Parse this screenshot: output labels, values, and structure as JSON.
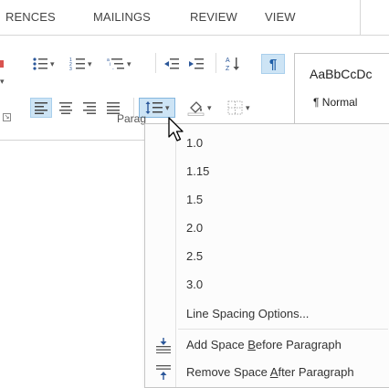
{
  "tabs": [
    {
      "label": "RENCES"
    },
    {
      "label": "MAILINGS"
    },
    {
      "label": "REVIEW"
    },
    {
      "label": "VIEW"
    }
  ],
  "ribbon": {
    "paragraph_group_label": "Parag",
    "styles": {
      "sample_text": "AaBbCcDc",
      "style_name": "¶ Normal"
    }
  },
  "line_spacing_menu": {
    "items": [
      {
        "label": "1.0"
      },
      {
        "label": "1.15"
      },
      {
        "label": "1.5"
      },
      {
        "label": "2.0"
      },
      {
        "label": "2.5"
      },
      {
        "label": "3.0"
      }
    ],
    "options_label": "Line Spacing Options...",
    "add_space_before": {
      "pre": "Add Space ",
      "accel": "B",
      "post": "efore Paragraph"
    },
    "remove_space_after": {
      "pre": "Remove Space ",
      "accel": "A",
      "post": "fter Paragraph"
    }
  },
  "colors": {
    "pressed_bg": "#cde4f5",
    "pressed_border": "#a9cfec",
    "accent_blue": "#2b579a",
    "pilcrow_blue": "#1f5fa8"
  },
  "icons": [
    "bullets-icon",
    "numbering-icon",
    "multilevel-list-icon",
    "decrease-indent-icon",
    "increase-indent-icon",
    "sort-icon",
    "show-formatting-icon",
    "align-left-icon",
    "align-center-icon",
    "align-right-icon",
    "justify-icon",
    "line-spacing-icon",
    "shading-icon",
    "borders-icon",
    "add-space-before-icon",
    "remove-space-after-icon",
    "mouse-cursor-icon"
  ]
}
